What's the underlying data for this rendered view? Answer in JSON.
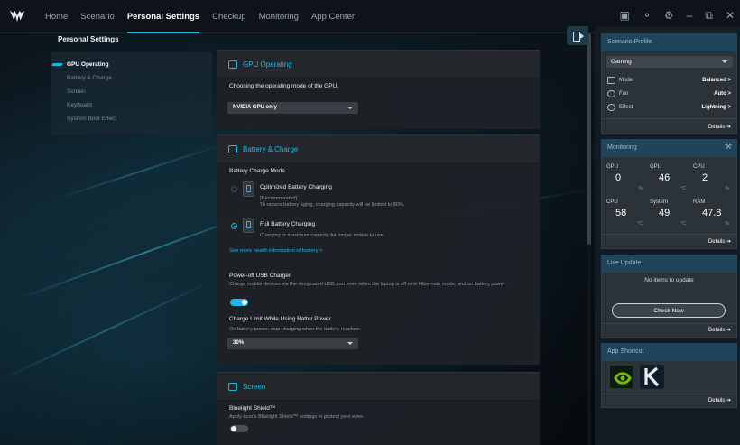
{
  "top_nav": {
    "items": [
      "Home",
      "Scenario",
      "Personal Settings",
      "Checkup",
      "Monitoring",
      "App Center"
    ],
    "active": "Personal Settings"
  },
  "window_controls": [
    "headset-icon",
    "support-icon",
    "settings-icon",
    "minimize-icon",
    "restore-icon",
    "close-icon"
  ],
  "sidebar": {
    "title": "Personal Settings",
    "items": [
      "GPU Operating",
      "Battery & Charge",
      "Screen",
      "Keyboard",
      "System Boot Effect"
    ],
    "active": "GPU Operating"
  },
  "gpu": {
    "title": "GPU Operating",
    "desc": "Choosing the operating mode of the GPU.",
    "mode_value": "NVIDIA GPU only"
  },
  "battery": {
    "title": "Battery & Charge",
    "mode_label": "Battery Charge Mode",
    "opt1_title": "Optimized Battery Charging",
    "opt1_rec": "[Recommended]",
    "opt1_desc": "To reduce battery aging, charging capacity will be limited to 80%.",
    "opt2_title": "Full Battery Charging",
    "opt2_desc": "Charging to maximum capacity for longer mobile to use.",
    "selected_option": "Full Battery Charging",
    "health_link": "See more health information of battery  >",
    "usb_title": "Power-off USB Charger",
    "usb_desc": "Charge mobile devices via the designated USB port even when the laptop is off or in Hibernate mode, and on battery power.",
    "usb_enabled": true,
    "limit_title": "Charge Limit While Using Batter Power",
    "limit_desc": "On battery power, stop charging when the battery reaches:",
    "limit_value": "30%"
  },
  "screen": {
    "title": "Screen",
    "bluelight_title": "Bluelight Shield™",
    "bluelight_desc": "Apply Acer's Bluelight Shield™ settings to protect your eyes.",
    "bluelight_enabled": false
  },
  "scenario_profile": {
    "title": "Scenario Profile",
    "profile": "Gaming",
    "rows": [
      {
        "label": "Mode",
        "value": "Balanced  >",
        "icon": "mode-icon"
      },
      {
        "label": "Fan",
        "value": "Auto  >",
        "icon": "fan-icon"
      },
      {
        "label": "Effect",
        "value": "Lightning  >",
        "icon": "effect-icon"
      }
    ],
    "details": "Details  ➔"
  },
  "monitoring": {
    "title": "Monitoring",
    "cells": [
      {
        "label": "GPU",
        "value": "0",
        "unit": "%"
      },
      {
        "label": "GPU",
        "value": "46",
        "unit": "°C"
      },
      {
        "label": "CPU",
        "value": "2",
        "unit": "%"
      },
      {
        "label": "CPU",
        "value": "58",
        "unit": "°C"
      },
      {
        "label": "System",
        "value": "49",
        "unit": "°C"
      },
      {
        "label": "RAM",
        "value": "47.8",
        "unit": "%"
      }
    ],
    "details": "Details  ➔"
  },
  "live_update": {
    "title": "Live Update",
    "empty": "No items to update",
    "button": "Check Now",
    "details": "Details  ➔"
  },
  "app_shortcut": {
    "title": "App Shortcut",
    "apps": [
      "nvidia-app-icon",
      "k-app-icon"
    ],
    "details": "Details  ➔"
  },
  "colors": {
    "accent": "#1cb7e6",
    "panel_head": "#20455a",
    "card_bg": "#1e2126"
  }
}
